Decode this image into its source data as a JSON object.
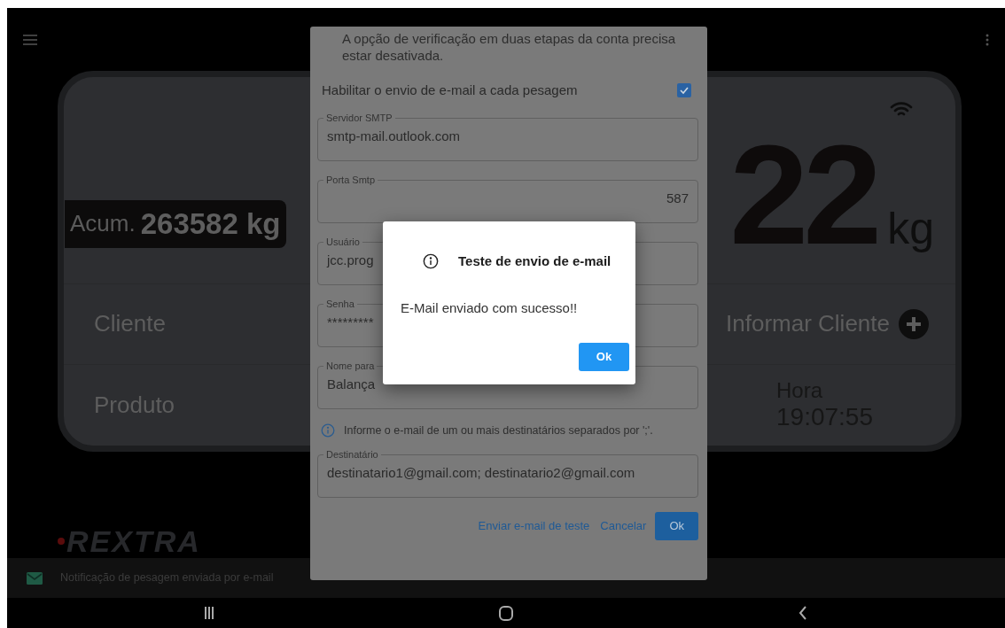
{
  "scale": {
    "accumulated_label": "Acum.",
    "accumulated_value": "263582 kg",
    "weight": "22",
    "unit": "kg",
    "rows": [
      {
        "kind": "client",
        "label": "Cliente",
        "action": "Informar Cliente"
      },
      {
        "kind": "time",
        "label": "Produto",
        "time_label": "Hora",
        "time": "19:07:55"
      }
    ]
  },
  "logo": "REXTRA",
  "snackbar": {
    "message": "Notificação de pesagem enviada por e-mail"
  },
  "settings_dialog": {
    "notice_lines": [
      "A opção de verificação em duas etapas da conta precisa",
      "estar desativada."
    ],
    "enable_email": {
      "label": "Habilitar o envio de e-mail a cada pesagem",
      "checked": true
    },
    "fields": [
      {
        "label": "Servidor SMTP",
        "value": "smtp-mail.outlook.com",
        "kind": "text"
      },
      {
        "label": "Porta Smtp",
        "value": "587",
        "kind": "number"
      },
      {
        "label": "Usuário",
        "value": "jcc.prog",
        "kind": "text"
      },
      {
        "label": "Senha",
        "value": "*********",
        "kind": "password"
      },
      {
        "label": "Nome para",
        "value": "Balança",
        "kind": "text"
      }
    ],
    "hint": "Informe o e-mail de um ou mais destinatários separados por ';'.",
    "recipient": {
      "label": "Destinatário",
      "value": "destinatario1@gmail.com; destinatario2@gmail.com"
    },
    "buttons": [
      {
        "label": "Enviar e-mail de teste",
        "kind": "text"
      },
      {
        "label": "Cancelar",
        "kind": "text"
      },
      {
        "label": "Ok",
        "kind": "filled"
      }
    ]
  },
  "alert": {
    "title": "Teste de envio de e-mail",
    "message": "E-Mail enviado com sucesso!!",
    "button": "Ok"
  }
}
